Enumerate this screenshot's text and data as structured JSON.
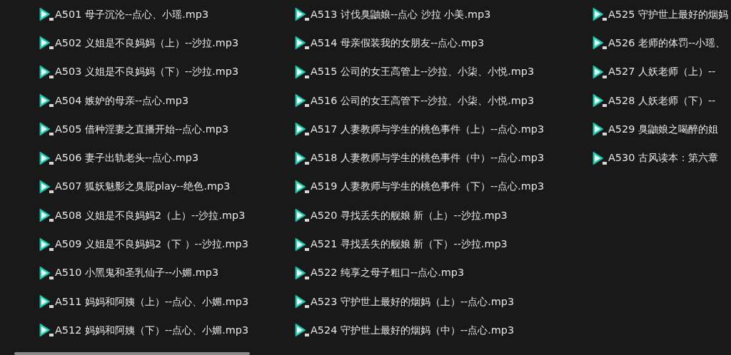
{
  "files": [
    {
      "name": "A501 母子沉沦--点心、小瑶.mp3"
    },
    {
      "name": "A502 义姐是不良妈妈（上）--沙拉.mp3"
    },
    {
      "name": "A503 义姐是不良妈妈（下）--沙拉.mp3"
    },
    {
      "name": "A504 嫉妒的母亲--点心.mp3"
    },
    {
      "name": "A505 借种淫妻之直播开始--点心.mp3"
    },
    {
      "name": "A506 妻子出轨老头--点心.mp3"
    },
    {
      "name": "A507 狐妖魅影之臭屁play--绝色.mp3"
    },
    {
      "name": "A508 义姐是不良妈妈2（上）--沙拉.mp3"
    },
    {
      "name": "A509 义姐是不良妈妈2（下 ）--沙拉.mp3"
    },
    {
      "name": "A510 小黑鬼和圣乳仙子--小媚.mp3"
    },
    {
      "name": "A511 妈妈和阿姨（上）--点心、小媚.mp3"
    },
    {
      "name": "A512 妈妈和阿姨（下）--点心、小媚.mp3"
    },
    {
      "name": "A513 讨伐臭鼬娘--点心 沙拉 小美.mp3"
    },
    {
      "name": "A514 母亲假装我的女朋友--点心.mp3"
    },
    {
      "name": "A515 公司的女王高管上--沙拉、小柒、小悦.mp3"
    },
    {
      "name": "A516 公司的女王高管下--沙拉、小柒、小悦.mp3"
    },
    {
      "name": "A517 人妻教师与学生的桃色事件（上）--点心.mp3"
    },
    {
      "name": "A518 人妻教师与学生的桃色事件（中）--点心.mp3"
    },
    {
      "name": "A519 人妻教师与学生的桃色事件（下）--点心.mp3"
    },
    {
      "name": "A520 寻找丢失的舰娘 新（上）--沙拉.mp3"
    },
    {
      "name": "A521 寻找丢失的舰娘 新（下）--沙拉.mp3"
    },
    {
      "name": "A522 纯享之母子粗口--点心.mp3"
    },
    {
      "name": "A523 守护世上最好的烟妈（上）--点心.mp3"
    },
    {
      "name": "A524 守护世上最好的烟妈（中）--点心.mp3"
    },
    {
      "name": "A525 守护世上最好的烟妈"
    },
    {
      "name": "A526 老师的体罚--小瑶、"
    },
    {
      "name": "A527 人妖老师（上）--"
    },
    {
      "name": "A528 人妖老师（下）--"
    },
    {
      "name": "A529 臭鼬娘之喝醉的姐"
    },
    {
      "name": "A530 古风读本：第六章"
    }
  ]
}
